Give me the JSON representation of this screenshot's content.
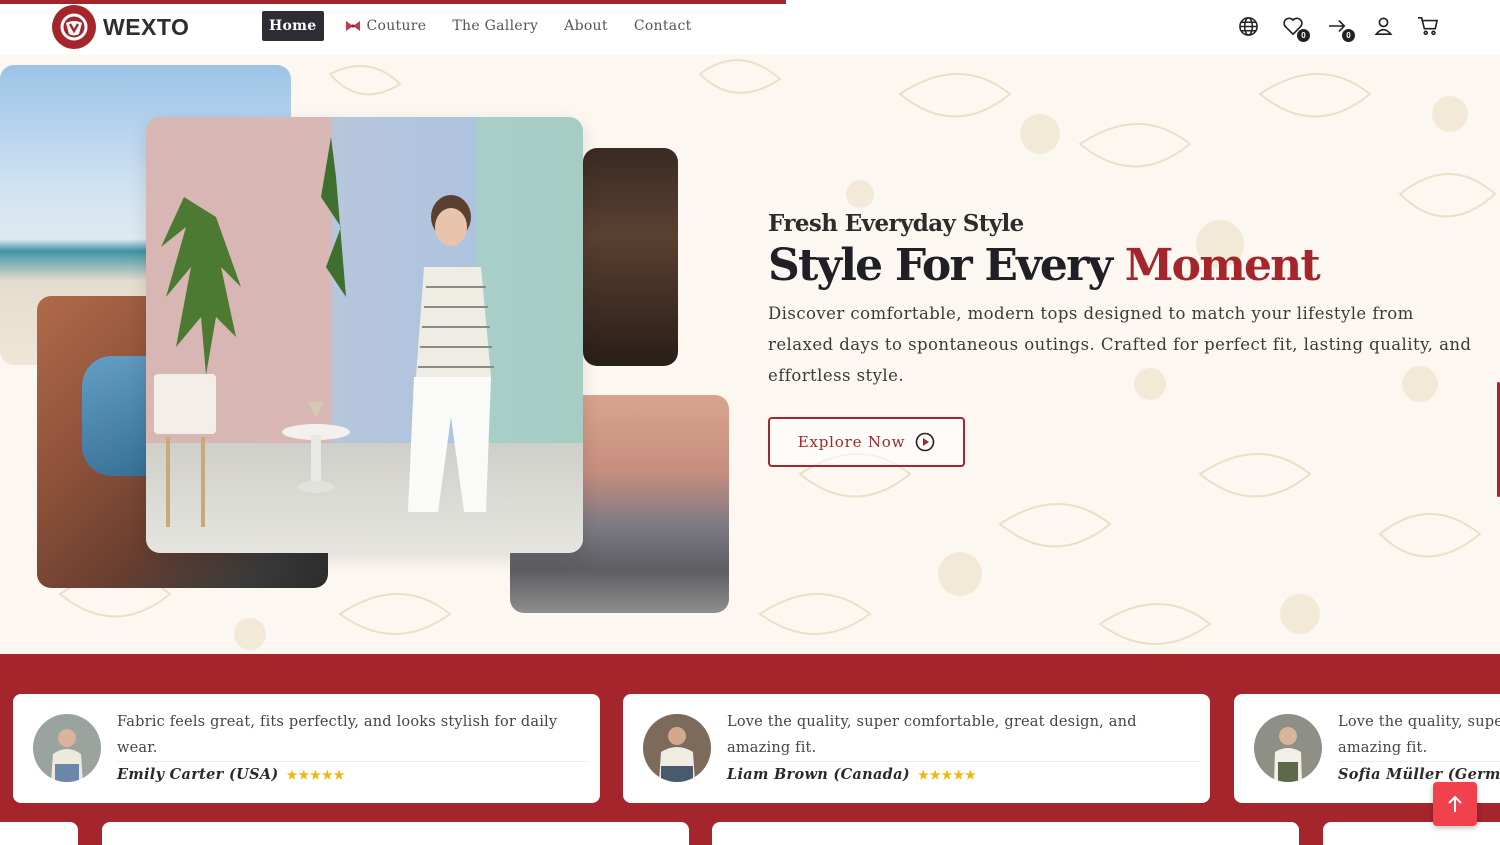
{
  "brand": {
    "name": "WEXTO",
    "accent": "#a4262c"
  },
  "nav": {
    "items": [
      {
        "label": "Home",
        "active": true
      },
      {
        "label": "Couture",
        "active": false,
        "icon": "bow-icon"
      },
      {
        "label": "The Gallery",
        "active": false
      },
      {
        "label": "About",
        "active": false
      },
      {
        "label": "Contact",
        "active": false
      }
    ]
  },
  "header_icons": {
    "wishlist_count": "0",
    "compare_count": "0"
  },
  "hero": {
    "kicker": "Fresh Everyday Style",
    "title_main": "Style For Every ",
    "title_accent": "Moment",
    "description": "Discover comfortable, modern tops designed to match your lifestyle from relaxed days to spontaneous outings. Crafted for perfect fit, lasting quality, and effortless style.",
    "cta_label": "Explore Now"
  },
  "testimonials": [
    {
      "quote": "Fabric feels great, fits perfectly, and looks stylish for daily wear.",
      "author": "Emily Carter (USA)",
      "stars": "★★★★★"
    },
    {
      "quote": "Love the quality, super comfortable, great design, and amazing fit.",
      "author": "Liam Brown (Canada)",
      "stars": "★★★★★"
    },
    {
      "quote": "Love the quality, super comfortable, great design, and amazing fit.",
      "author": "Sofia Müller (Germany)",
      "stars": "★★★★★"
    }
  ]
}
